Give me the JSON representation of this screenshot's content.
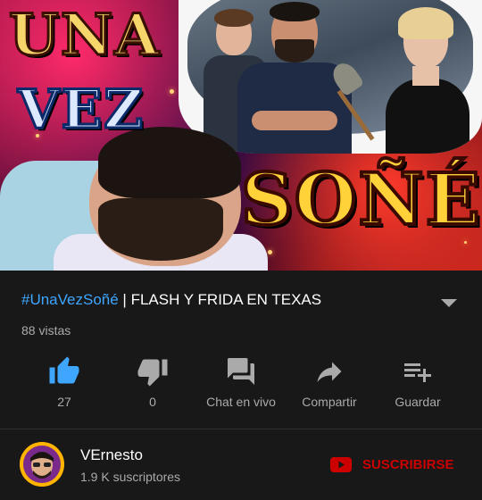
{
  "thumbnail": {
    "line1": "UNA",
    "line2": "VEZ",
    "line3": "SOÑÉ"
  },
  "video": {
    "hashtag": "#UnaVezSoñé",
    "separator": " | ",
    "title": "FLASH Y FRIDA EN TEXAS",
    "views": "88 vistas"
  },
  "actions": [
    {
      "icon": "thumbs-up-icon",
      "label": "27"
    },
    {
      "icon": "thumbs-down-icon",
      "label": "0"
    },
    {
      "icon": "chat-icon",
      "label": "Chat en vivo"
    },
    {
      "icon": "share-icon",
      "label": "Compartir"
    },
    {
      "icon": "save-to-playlist-icon",
      "label": "Guardar"
    }
  ],
  "channel": {
    "name": "VErnesto",
    "subscribers": "1.9 K suscriptores",
    "subscribe_label": "SUSCRIBIRSE"
  },
  "colors": {
    "background": "#181818",
    "accent_link": "#3ea6ff",
    "like_active": "#3ea6ff",
    "subscribe_red": "#cc0000",
    "secondary_text": "#aaaaaa"
  }
}
